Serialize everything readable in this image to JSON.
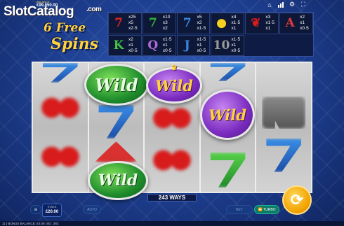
{
  "brand": {
    "watermark": "SlotCatalog",
    "watermark_suffix": ".com"
  },
  "game_logo": {
    "line1": "6 Free",
    "line2": "Spins"
  },
  "top_bar": {
    "balance_label": "BALANCE",
    "balance_value": "£99,850.00",
    "icons": [
      "home-icon",
      "chart-icon",
      "gear-icon",
      "fullscreen-icon"
    ]
  },
  "paytable": [
    {
      "symbol": "7",
      "name": "red-seven",
      "color": "#e02424",
      "pays": [
        "x25",
        "x5",
        "x2·5"
      ]
    },
    {
      "symbol": "7",
      "name": "green-seven",
      "color": "#33b533",
      "pays": [
        "x10",
        "x3",
        "x2"
      ]
    },
    {
      "symbol": "7",
      "name": "blue-seven",
      "color": "#3a86e0",
      "pays": [
        "x5",
        "x2",
        "x1·5"
      ]
    },
    {
      "symbol": "●",
      "name": "lemon",
      "color": "#f5d020",
      "pays": [
        "x4",
        "x1·5",
        "x1"
      ]
    },
    {
      "symbol": "❦",
      "name": "cherry",
      "color": "#d81b1b",
      "pays": [
        "x3",
        "x1·5",
        "x1"
      ]
    },
    {
      "symbol": "A",
      "name": "ace",
      "color": "#e23a3a",
      "pays": [
        "x2",
        "x1",
        "x0·5"
      ]
    },
    {
      "symbol": "K",
      "name": "king",
      "color": "#45c045",
      "pays": [
        "x2",
        "x1",
        "x0·5"
      ]
    },
    {
      "symbol": "Q",
      "name": "queen",
      "color": "#b06ad6",
      "pays": [
        "x1·5",
        "x1",
        "x0·5"
      ]
    },
    {
      "symbol": "J",
      "name": "jack",
      "color": "#3a86e0",
      "pays": [
        "x1·5",
        "x1",
        "x0·5"
      ]
    },
    {
      "symbol": "10",
      "name": "ten",
      "color": "#9a9a9a",
      "pays": [
        "x1·5",
        "x1",
        "x0·5"
      ]
    }
  ],
  "wilds": {
    "label": "Wild"
  },
  "ways": {
    "text": "243 WAYS"
  },
  "stake": {
    "label": "STAKE",
    "value": "£20.00"
  },
  "buttons": {
    "auto": "AUTO",
    "bet": "BET",
    "turbo": "TURBO"
  },
  "footer": {
    "text": "11 | BONUS BALANCE: £0.00 | 00 : 283"
  }
}
